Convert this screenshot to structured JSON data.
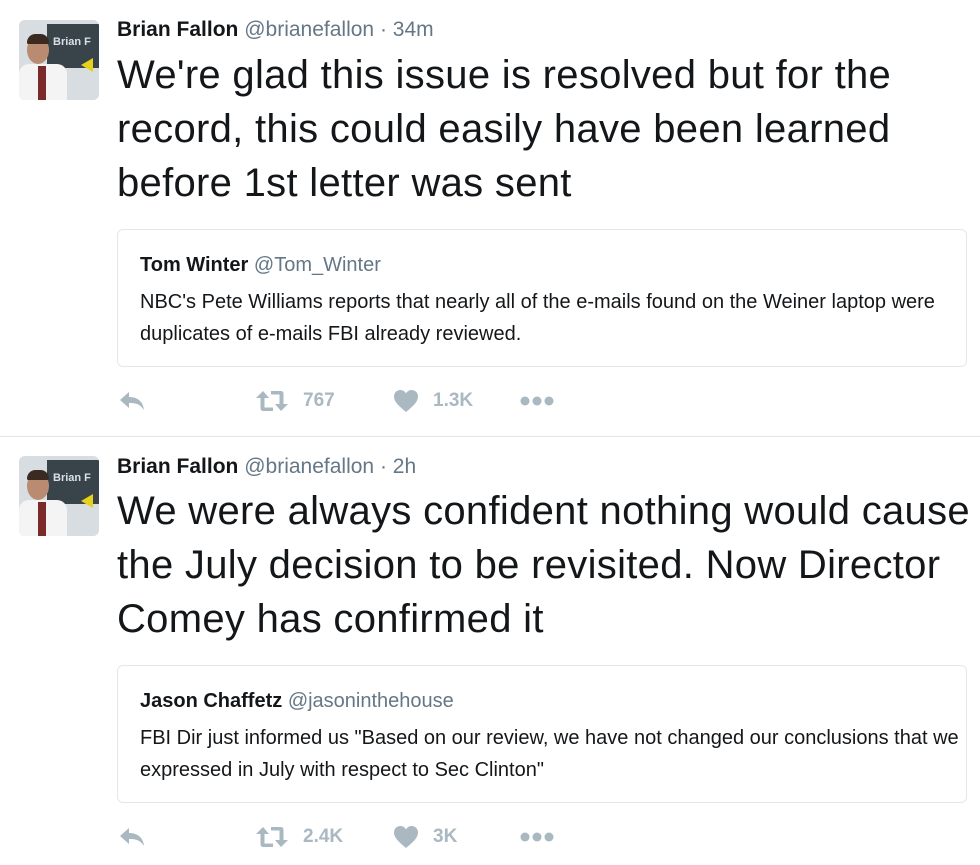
{
  "tweets": [
    {
      "author_name": "Brian Fallon",
      "author_handle": "@brianefallon",
      "separator": "·",
      "time": "34m",
      "avatar_text": "Brian F",
      "text": "We're glad this issue is resolved but for the record, this could easily have been learned before 1st letter was sent",
      "quote": {
        "author_name": "Tom Winter",
        "author_handle": "@Tom_Winter",
        "text": "NBC's Pete Williams reports that nearly all of the e-mails found on the Weiner laptop were duplicates of e-mails FBI already reviewed."
      },
      "retweet_count": "767",
      "like_count": "1.3K"
    },
    {
      "author_name": "Brian Fallon",
      "author_handle": "@brianefallon",
      "separator": "·",
      "time": "2h",
      "avatar_text": "Brian F",
      "text": "We were always confident nothing would cause the July decision to be revisited. Now Director Comey has confirmed it",
      "quote": {
        "author_name": "Jason Chaffetz",
        "author_handle": "@jasoninthehouse",
        "text": "FBI Dir just informed us \"Based on our review, we have not changed our conclusions that we expressed in July with respect to Sec Clinton\""
      },
      "retweet_count": "2.4K",
      "like_count": "3K"
    }
  ],
  "icons": [
    "reply-icon",
    "retweet-icon",
    "heart-icon",
    "more-icon"
  ],
  "colors": {
    "text": "#14171a",
    "secondary": "#657786",
    "action": "#aab8c2",
    "border": "#e1e8ed"
  }
}
